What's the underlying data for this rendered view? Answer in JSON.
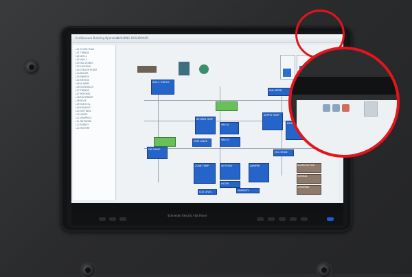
{
  "screen": {
    "titlebar_text": "EcoStruxure Building Operation",
    "window_title": "BUILDING DASHBOARD",
    "sidebar_items": [
      "L01 FLOOR PLAN",
      "L01 TRENDS",
      "L02 AHU-1",
      "L02 AHU-2",
      "L03 VAV ZONES",
      "L03 LIGHTING",
      "L04 CHILLER PLANT",
      "L04 BOILER",
      "L05 ENERGY",
      "L05 METERS",
      "L06 ALARMS",
      "L06 SCHEDULES",
      "L07 TRENDS",
      "L07 REPORTS",
      "L08 EQUIPMENT",
      "L08 ROOF",
      "L09 FAN COIL",
      "L09 EXHAUST",
      "L10 SETTINGS",
      "L10 USERS",
      "L11 GRAPHICS",
      "L11 NETWORK",
      "L12 EVENTS",
      "L12 HISTORY"
    ],
    "panels": [
      "AHU-1 STATUS",
      "FAN SPEED",
      "SUPPLY TEMP",
      "RETURN TEMP",
      "VAV-01",
      "VAV-02",
      "CHW VALVE",
      "HW VALVE",
      "ZONE TEMP",
      "SETPOINT",
      "DAMPER",
      "FILTER",
      "EXHAUST FAN",
      "OCC MODE",
      "CO2 LEVEL",
      "HUMIDITY"
    ],
    "status_labels": [
      "ALARM ACTIVE",
      "NORMAL",
      "OVERRIDE"
    ],
    "footer_center": "Schneider Electric  Flat Panel"
  },
  "gauges": [
    0.45,
    0.62,
    0.58,
    0.72,
    0.35
  ],
  "colors": {
    "panel_blue": "#2565c9",
    "panel_green": "#69c05a",
    "panel_brown": "#8d7a6a",
    "highlight_circle": "#e6141a",
    "housing": "#2b2c2e"
  }
}
